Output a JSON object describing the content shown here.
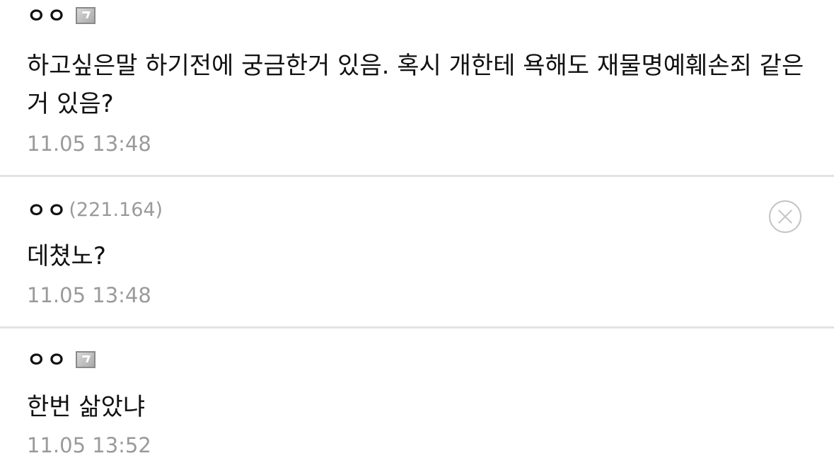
{
  "comments": [
    {
      "author": "ㅇㅇ",
      "ip": "",
      "has_gallog_icon": true,
      "text": "하고싶은말 하기전에 궁금한거 있음. 혹시 개한테 욕해도 재물명예훼손죄 같은거 있음?",
      "timestamp": "11.05 13:48"
    },
    {
      "author": "ㅇㅇ",
      "ip": "(221.164)",
      "has_gallog_icon": false,
      "has_delete_button": true,
      "text": "데쳤노?",
      "timestamp": "11.05 13:48"
    },
    {
      "author": "ㅇㅇ",
      "ip": "",
      "has_gallog_icon": true,
      "text": "한번 삶았냐",
      "timestamp": "11.05 13:52"
    }
  ],
  "icons": {
    "gallog": "gallog-icon",
    "delete": "close-circle-icon"
  },
  "colors": {
    "text": "#111111",
    "meta": "#9a9a9a",
    "divider": "#e3e3e3"
  }
}
